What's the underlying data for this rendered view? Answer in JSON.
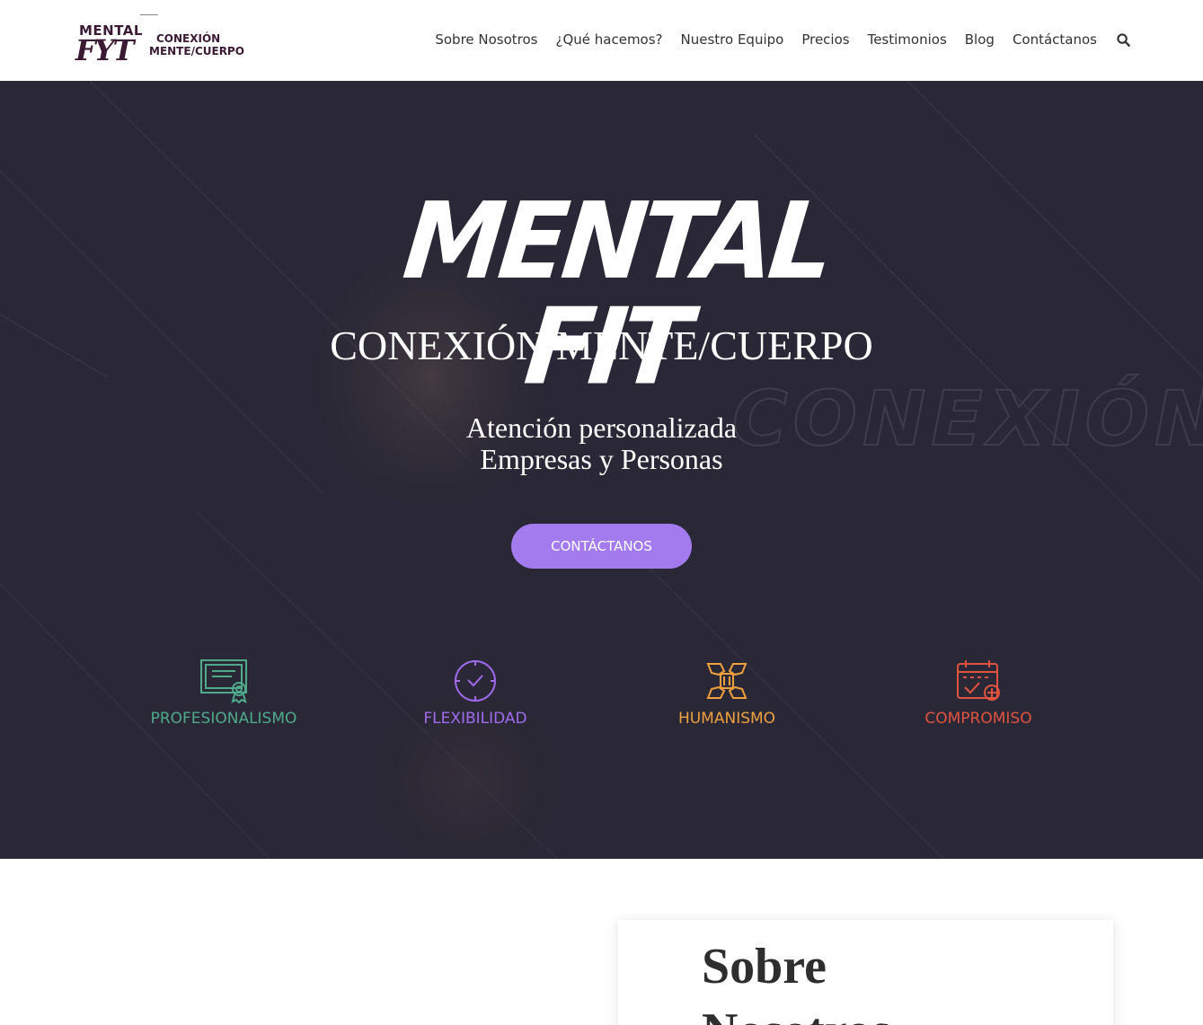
{
  "header": {
    "logo": {
      "word": "MENTAL",
      "mark": "FYT",
      "tagline_top": "CONEXIÓN",
      "tagline_bottom": "MENTE/CUERPO"
    },
    "nav": [
      {
        "label": "Sobre Nosotros"
      },
      {
        "label": "¿Qué hacemos?"
      },
      {
        "label": "Nuestro Equipo"
      },
      {
        "label": "Precios"
      },
      {
        "label": "Testimonios"
      },
      {
        "label": "Blog"
      },
      {
        "label": "Contáctanos"
      }
    ],
    "search_icon": "search-icon"
  },
  "hero": {
    "title": "MENTAL FIT",
    "subtitle": "CONEXIÓN MENTE/CUERPO",
    "line1": "Atención personalizada",
    "line2": "Empresas y Personas",
    "cta_label": "CONTÁCTANOS",
    "bg_watermark": "CONEXIÓN",
    "values": [
      {
        "label": "PROFESIONALISMO",
        "icon": "certificate-icon",
        "color": "#4fa98b"
      },
      {
        "label": "FLEXIBILIDAD",
        "icon": "clock-icon",
        "color": "#a06bf0"
      },
      {
        "label": "HUMANISMO",
        "icon": "joined-hands-icon",
        "color": "#f0a03c"
      },
      {
        "label": "COMPROMISO",
        "icon": "calendar-check-icon",
        "color": "#e2533f"
      }
    ]
  },
  "about": {
    "title": "Sobre Nosotros"
  },
  "colors": {
    "hero_bg": "#2a2836",
    "cta_bg": "#a37bef",
    "brand": "#3b1a33",
    "nav_text": "#333333"
  }
}
